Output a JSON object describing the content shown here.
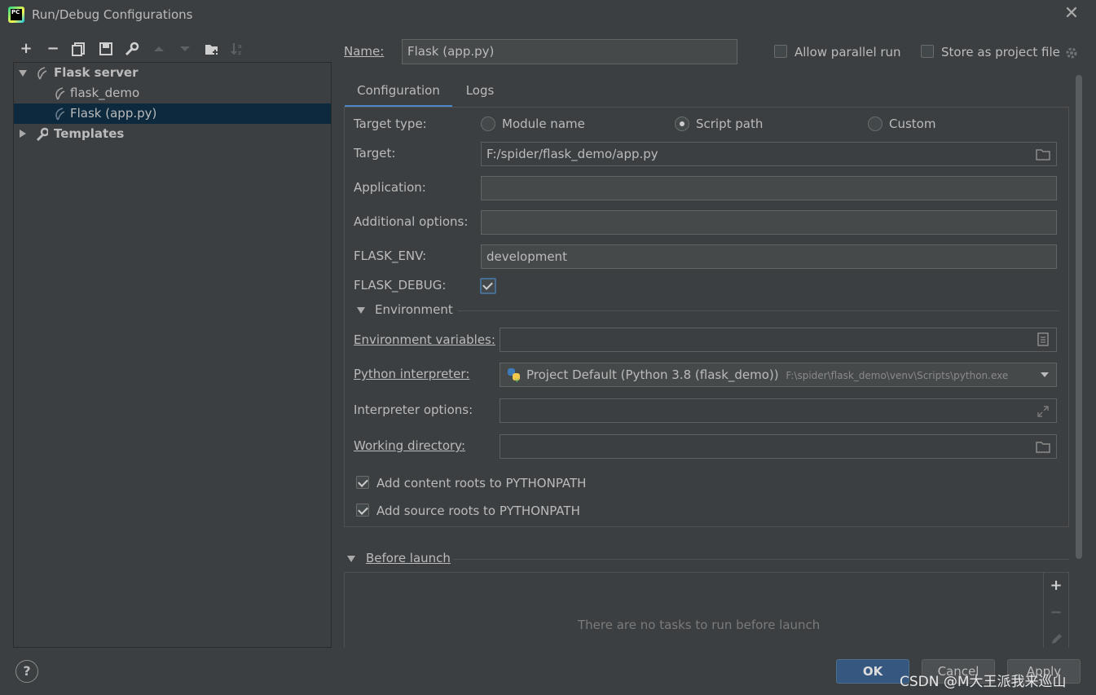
{
  "window": {
    "title": "Run/Debug Configurations"
  },
  "toolbar": {
    "icons": [
      "plus-icon",
      "minus-icon",
      "copy-icon",
      "save-icon",
      "wrench-icon",
      "arrow-up-icon",
      "arrow-down-icon",
      "new-folder-icon",
      "sort-az-icon"
    ]
  },
  "tree": {
    "items": [
      {
        "label": "Flask server",
        "expanded": true
      },
      {
        "label": "flask_demo"
      },
      {
        "label": "Flask (app.py)",
        "selected": true
      },
      {
        "label": "Templates",
        "expanded": false
      }
    ]
  },
  "header": {
    "name_label": "Name:",
    "name_value": "Flask (app.py)",
    "allow_parallel_label": "Allow parallel run",
    "allow_parallel_checked": false,
    "store_project_label": "Store as project file",
    "store_project_checked": false
  },
  "tabs": [
    {
      "label": "Configuration",
      "active": true
    },
    {
      "label": "Logs",
      "active": false
    }
  ],
  "config": {
    "target_type_label": "Target type:",
    "target_type_options": [
      "Module name",
      "Script path",
      "Custom"
    ],
    "target_type_selected": "Script path",
    "target_label": "Target:",
    "target_value": "F:/spider/flask_demo/app.py",
    "application_label": "Application:",
    "application_value": "",
    "additional_options_label": "Additional options:",
    "additional_options_value": "",
    "flask_env_label": "FLASK_ENV:",
    "flask_env_value": "development",
    "flask_debug_label": "FLASK_DEBUG:",
    "flask_debug_checked": true,
    "environment_section": "Environment",
    "env_vars_label": "Environment variables:",
    "env_vars_value": "",
    "interpreter_label": "Python interpreter:",
    "interpreter_value": "Project Default (Python 3.8 (flask_demo))",
    "interpreter_path": "F:\\spider\\flask_demo\\venv\\Scripts\\python.exe",
    "interpreter_options_label": "Interpreter options:",
    "interpreter_options_value": "",
    "working_dir_label": "Working directory:",
    "working_dir_value": "",
    "content_roots_label": "Add content roots to PYTHONPATH",
    "content_roots_checked": true,
    "source_roots_label": "Add source roots to PYTHONPATH",
    "source_roots_checked": true
  },
  "before_launch": {
    "title": "Before launch",
    "empty_text": "There are no tasks to run before launch"
  },
  "buttons": {
    "ok": "OK",
    "cancel": "Cancel",
    "apply": "Apply",
    "help": "?"
  },
  "watermark": "CSDN @M大王派我来巡山",
  "colors": {
    "background": "#3c3f41",
    "selection": "#0d293e",
    "accent": "#4a88c7",
    "ok_button": "#365880"
  }
}
